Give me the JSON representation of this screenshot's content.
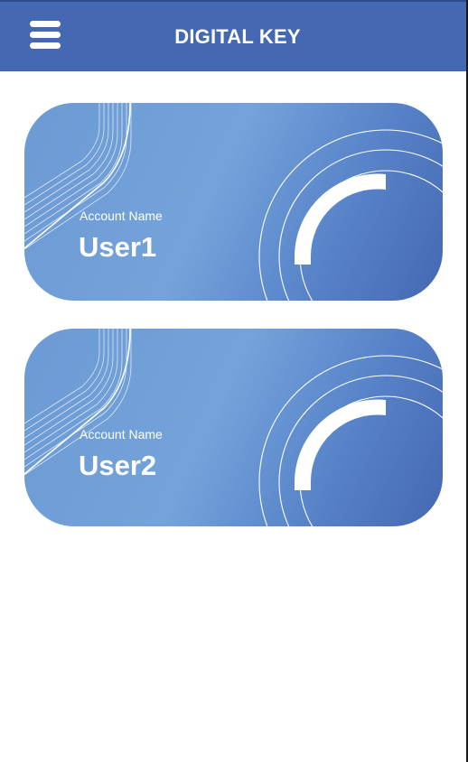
{
  "header": {
    "title": "DIGITAL KEY",
    "menu_icon": "hamburger-menu-icon",
    "background_color": "#4468b2"
  },
  "cards": [
    {
      "label": "Account Name",
      "name": "User1",
      "icon": "key-arc-icon"
    },
    {
      "label": "Account Name",
      "name": "User2",
      "icon": "key-arc-icon"
    }
  ],
  "colors": {
    "card_light": "#74a3da",
    "card_dark": "#4468b2",
    "text": "#ffffff"
  }
}
